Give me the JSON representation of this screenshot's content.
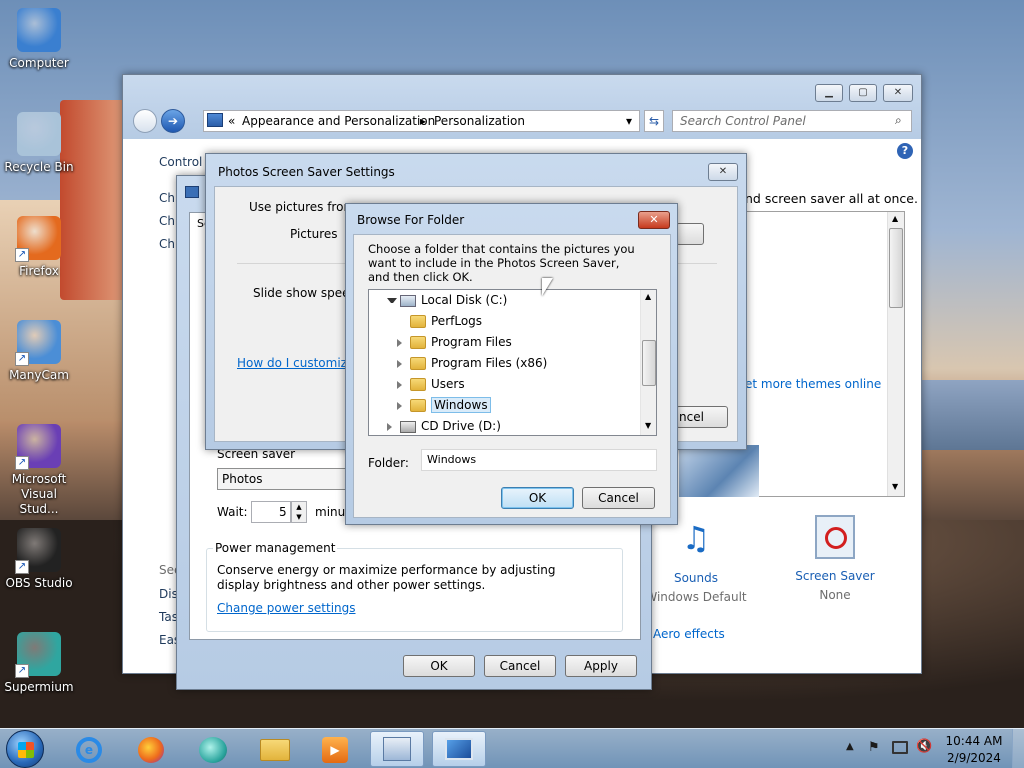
{
  "desktop": {
    "icons": [
      {
        "label": "Computer",
        "icon": "computer-icon",
        "color": "#3a7fd0"
      },
      {
        "label": "Recycle Bin",
        "icon": "recycle-bin-icon",
        "color": "#a9c3d9"
      },
      {
        "label": "Firefox",
        "icon": "firefox-icon",
        "color": "#e46a1e"
      },
      {
        "label": "ManyCam",
        "icon": "manycam-icon",
        "color": "#4b8ed6"
      },
      {
        "label": "Microsoft Visual Stud...",
        "icon": "visual-studio-icon",
        "color": "#6a3fb5"
      },
      {
        "label": "OBS Studio",
        "icon": "obs-icon",
        "color": "#222"
      },
      {
        "label": "Supermium",
        "icon": "supermium-icon",
        "color": "#2fa6a0"
      }
    ]
  },
  "personalization": {
    "address": [
      "Appearance and Personalization",
      "Personalization"
    ],
    "search_placeholder": "Search Control Panel",
    "control_panel_label": "Control P",
    "side_links": [
      "Ch",
      "Ch",
      "Ch"
    ],
    "main_text": "nd screen saver all at once.",
    "more_themes": "et more themes online",
    "see_also": "See",
    "bottom_links": [
      "Disp",
      "Tas",
      "Eas"
    ],
    "items": [
      {
        "title": "Sounds",
        "sub": "Windows Default"
      },
      {
        "title": "Screen Saver",
        "sub": "None"
      }
    ],
    "aero_link": "Aero effects"
  },
  "screen_saver_dialog": {
    "tab_label": "Sc",
    "group_label": "Screen saver",
    "selected": "Photos",
    "wait_label": "Wait:",
    "wait_value": "5",
    "minutes_label": "minu",
    "power_title": "Power management",
    "power_text": "Conserve energy or maximize performance by adjusting display brightness and other power settings.",
    "power_link": "Change power settings",
    "ok": "OK",
    "cancel": "Cancel",
    "apply": "Apply"
  },
  "photos_dialog": {
    "title": "Photos Screen Saver Settings",
    "use_pictures": "Use pictures from:",
    "pictures": "Pictures",
    "slide_speed": "Slide show speed:",
    "help_link": "How do I customize",
    "cancel_partial": "ncel"
  },
  "browse_dialog": {
    "title": "Browse For Folder",
    "instruction": "Choose a folder that contains the pictures you want to include in the Photos Screen Saver, and then click OK.",
    "tree": [
      {
        "label": "Local Disk (C:)",
        "level": 0,
        "expanded": true,
        "type": "drive"
      },
      {
        "label": "PerfLogs",
        "level": 1,
        "expanded": false,
        "type": "folder",
        "leaf": true
      },
      {
        "label": "Program Files",
        "level": 1,
        "type": "folder"
      },
      {
        "label": "Program Files (x86)",
        "level": 1,
        "type": "folder"
      },
      {
        "label": "Users",
        "level": 1,
        "type": "folder"
      },
      {
        "label": "Windows",
        "level": 1,
        "type": "folder",
        "selected": true
      },
      {
        "label": "CD Drive (D:)",
        "level": 0,
        "type": "cd"
      }
    ],
    "folder_label": "Folder:",
    "folder_value": "Windows",
    "ok": "OK",
    "cancel": "Cancel"
  },
  "taskbar": {
    "time": "10:44 AM",
    "date": "2/9/2024"
  }
}
